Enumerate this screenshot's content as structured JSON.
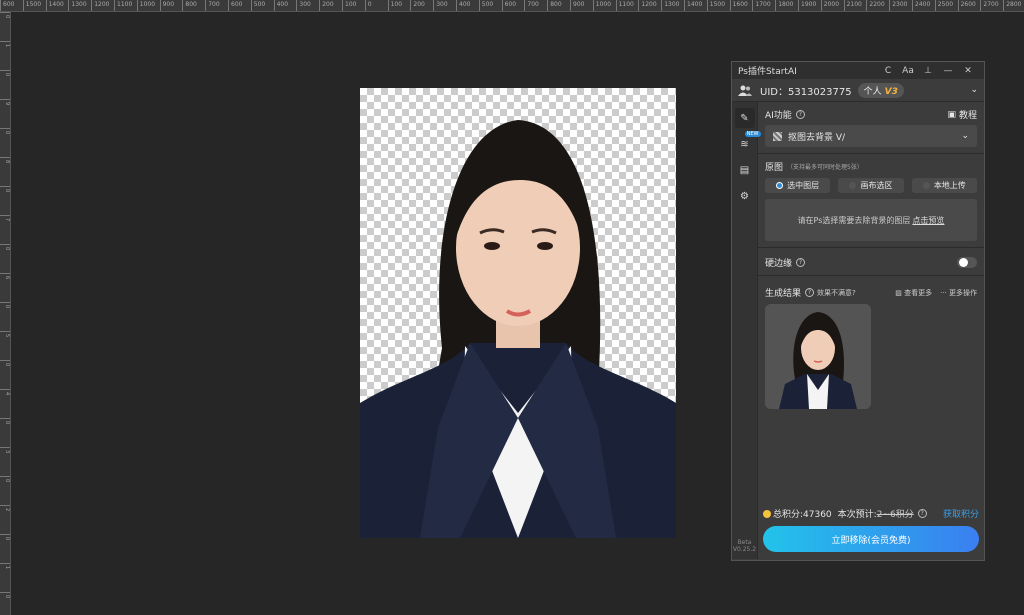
{
  "ruler": {
    "top_ticks": [
      "600",
      "1500",
      "1400",
      "1300",
      "1200",
      "1100",
      "1000",
      "900",
      "800",
      "700",
      "600",
      "500",
      "400",
      "300",
      "200",
      "100",
      "0",
      "100",
      "200",
      "300",
      "400",
      "500",
      "600",
      "700",
      "800",
      "900",
      "1000",
      "1100",
      "1200",
      "1300",
      "1400",
      "1500",
      "1600",
      "1700",
      "1800",
      "1900",
      "2000",
      "2100",
      "2200",
      "2300",
      "2400",
      "2500",
      "2600",
      "2700",
      "2800",
      "2900"
    ],
    "left_ticks": [
      "0",
      "1",
      "0",
      "9",
      "0",
      "8",
      "0",
      "7",
      "0",
      "6",
      "0",
      "5",
      "0",
      "4",
      "0",
      "3",
      "0",
      "2",
      "0",
      "1",
      "0"
    ]
  },
  "panel": {
    "title": "Ps插件StartAI",
    "title_icons": {
      "refresh": "C",
      "font": "Aa",
      "pin": "⊥",
      "minimize": "—",
      "close": "✕"
    },
    "user": {
      "uid": "UID：5313023775",
      "plan": "个人",
      "version_badge": "V3",
      "avatar_icon": "users-icon"
    },
    "sidebar": {
      "new_tag": "NEW",
      "beta": "Beta",
      "version": "V0.25.2"
    },
    "ai": {
      "label": "AI功能",
      "tutorial": "教程",
      "selected_function": "抠图去背景 V/"
    },
    "source": {
      "label": "原图",
      "sub": "（支持最多可同时处理5张）",
      "options": [
        "选中图层",
        "画布选区",
        "本地上传"
      ],
      "selected_index": 0,
      "hint": "请在Ps选择需要去除背景的图层",
      "hint_link": "点击预览"
    },
    "hard_edge": {
      "label": "硬边缘",
      "enabled": false
    },
    "result": {
      "label": "生成结果",
      "dissatisfied": "效果不满意?",
      "view_more": "查看更多",
      "more_actions": "更多操作"
    },
    "footer": {
      "total_points": "总积分:47360",
      "estimate_label": "本次预计:",
      "estimate_value": "2~6积分",
      "get_points": "获取积分",
      "cta": "立即移除(会员免费)"
    }
  },
  "colors": {
    "accent": "#2a8cd8",
    "cta_start": "#22c3ea",
    "cta_end": "#3a7ff0",
    "coin": "#f5c33b"
  }
}
